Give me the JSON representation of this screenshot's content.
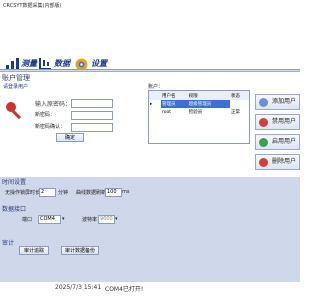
{
  "window": {
    "title": "CRCSYT数据采集(内部版)"
  },
  "toolbar": {
    "items": [
      {
        "label": "测量",
        "icon": "measure-icon"
      },
      {
        "label": "数据",
        "icon": "data-icon"
      },
      {
        "label": "设置",
        "icon": "gear-icon"
      }
    ]
  },
  "user_mgmt": {
    "title": "账户管理",
    "login_label": "请登录用户",
    "old_pwd_label": "输入原密码：",
    "new_pwd_label": "新密码：",
    "confirm_pwd_label": "新密码确认：",
    "confirm_button": "确定"
  },
  "accounts": {
    "title": "账户：",
    "columns": [
      "用户名",
      "权限",
      "状态"
    ],
    "rows": [
      {
        "marker": "▸",
        "name": "管理员",
        "role": "超级管理员",
        "status": ""
      },
      {
        "marker": "",
        "name": "root",
        "role": "检验员",
        "status": "正常"
      }
    ],
    "buttons": {
      "add": "添加用户",
      "disable": "禁用用户",
      "enable": "启用用户",
      "delete": "删除用户"
    }
  },
  "timing": {
    "title": "时间设置",
    "no_op_label": "无操作锁屏时长",
    "no_op_value": "2",
    "no_op_unit": "分钟",
    "interval_label": "曲线数据刷新为",
    "interval_value": "100",
    "interval_unit": "ms"
  },
  "data_acq": {
    "title": "数据接口",
    "port_label": "端口",
    "port_value": "COM4",
    "baud_label": "波特率",
    "baud_value": "9600"
  },
  "audit": {
    "title": "审计",
    "btn1": "审计追踪",
    "btn2": "审计数据备份"
  },
  "status": {
    "datetime": "2025/7/3 15:41",
    "message": "COM4已打开!"
  },
  "colors": {
    "accent": "#1d3a8a",
    "panel": "#cfd7ea",
    "selection": "#3d6fd6"
  }
}
